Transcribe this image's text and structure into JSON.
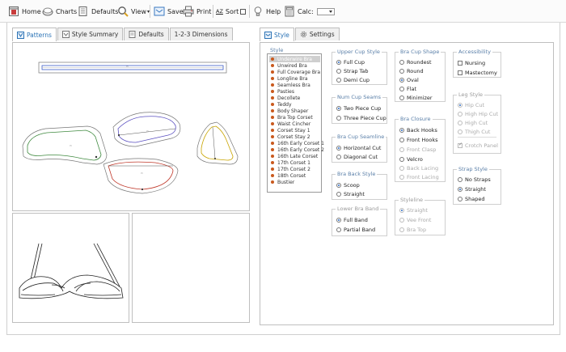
{
  "toolbar": {
    "home": "Home",
    "charts": "Charts",
    "defaults": "Defaults",
    "view": "View",
    "save": "Save",
    "print": "Print",
    "sort_glyph": "AZ",
    "sort": "Sort",
    "help": "Help",
    "calc": "Calc:"
  },
  "left_tabs": [
    "Patterns",
    "Style Summary",
    "Defaults",
    "1-2-3 Dimensions"
  ],
  "right_tabs": [
    "Style",
    "Settings"
  ],
  "style_list": {
    "title": "Style",
    "items": [
      "Underwire Bra",
      "Unwired Bra",
      "Full Coverage Bra",
      "Longline Bra",
      "Seamless Bra",
      "Pasties",
      "Decollete",
      "Teddy",
      "Body Shaper",
      "Bra Top Corset",
      "Waist Cincher",
      "Corset Stay 1",
      "Corset Stay 2",
      "16th Early Corset 1",
      "16th Early Corset 2",
      "16th Late Corset",
      "17th Corset 1",
      "17th Corset 2",
      "18th Corset",
      "Bustier"
    ],
    "selected": 0
  },
  "groups": {
    "upper_cup_style": {
      "title": "Upper Cup Style",
      "options": [
        "Full Cup",
        "Strap Tab",
        "Demi Cup"
      ]
    },
    "num_cup_seams": {
      "title": "Num Cup Seams",
      "options": [
        "Two Piece Cup",
        "Three Piece Cup"
      ]
    },
    "bra_cup_seamline": {
      "title": "Bra Cup Seamline",
      "options": [
        "Horizontal Cut",
        "Diagonal Cut"
      ]
    },
    "bra_back_style": {
      "title": "Bra Back Style",
      "options": [
        "Scoop",
        "Straight"
      ]
    },
    "lower_bra_band": {
      "title": "Lower Bra Band",
      "options": [
        "Full Band",
        "Partial Band"
      ]
    },
    "bra_cup_shape": {
      "title": "Bra Cup Shape",
      "options": [
        "Roundest",
        "Round",
        "Oval",
        "Flat",
        "Minimizer"
      ]
    },
    "bra_closure": {
      "title": "Bra Closure",
      "options": [
        "Back Hooks",
        "Front Hooks",
        "Front Clasp",
        "Velcro",
        "Back Lacing",
        "Front Lacing"
      ]
    },
    "styleline": {
      "title": "Styleline",
      "options": [
        "Straight",
        "Vee Front",
        "Bra Top"
      ]
    },
    "accessibility": {
      "title": "Accessibility",
      "options": [
        "Nursing",
        "Mastectomy"
      ]
    },
    "leg_style": {
      "title": "Leg Style",
      "options": [
        "Hip Cut",
        "High Hip Cut",
        "High Cut",
        "Thigh Cut",
        "Crotch Panel"
      ]
    },
    "strap_style": {
      "title": "Strap Style",
      "options": [
        "No Straps",
        "Straight",
        "Shaped"
      ]
    }
  },
  "colors": {
    "accent": "#2a72b5",
    "group_title": "#5a7fa8",
    "list_bullet": "#c9591d"
  }
}
